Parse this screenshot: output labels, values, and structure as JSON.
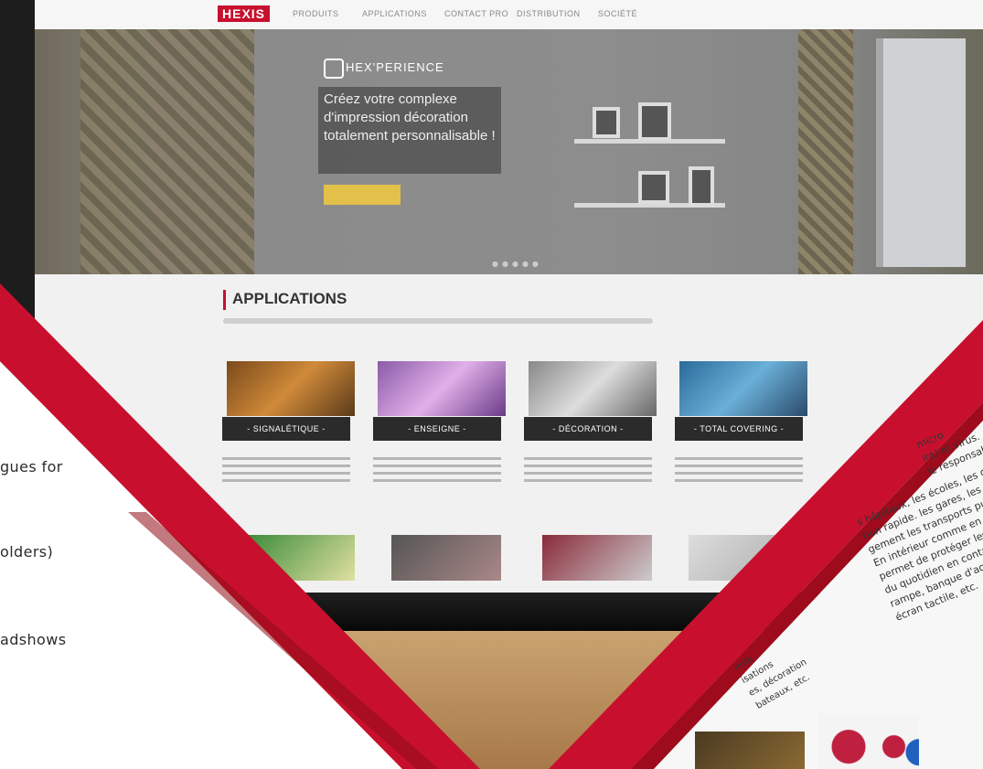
{
  "site": {
    "logo": "HEXIS",
    "nav": [
      "PRODUITS",
      "APPLICATIONS",
      "CONTACT PRO",
      "DISTRIBUTION",
      "SOCIÉTÉ"
    ],
    "hero_brand": "HEX'PERIENCE",
    "hero_lines": [
      "Créez votre complexe",
      "d'impression décoration",
      "totalement personnalisable !"
    ],
    "section_title": "APPLICATIONS",
    "apps": [
      {
        "label": "- SIGNALÉTIQUE -"
      },
      {
        "label": "- ENSEIGNE -"
      },
      {
        "label": "- DÉCORATION -"
      },
      {
        "label": "- TOTAL COVERING -"
      }
    ]
  },
  "left_fragments": [
    "gues  for",
    "olders)",
    "adshows"
  ],
  "paper_right": [
    "s hôpitaux, les écoles, les c",
    "tion rapide. les gares, les aé",
    "gement les transports publics, ou enc",
    "En intérieur comme en extérieur, PU",
    "permet de protéger les surfaces et",
    "du quotidien en contact avec l'huma",
    "rampe, banque d'accueil, téléphon",
    "écran tactile, etc."
  ],
  "paper_right_top": [
    "micro",
    "ire) et virus.",
    "le responsable d"
  ],
  "paper_left": [
    "ente",
    "isations",
    "es, décoration",
    "bateaux, etc."
  ],
  "colors": {
    "brand_red": "#c8102e",
    "dark_red": "#8f0c15",
    "accent_yellow": "#e2c04a"
  }
}
